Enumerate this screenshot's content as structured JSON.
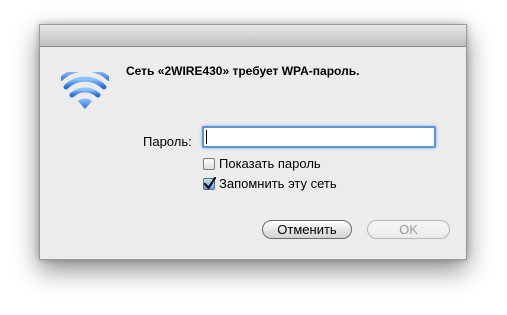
{
  "dialog": {
    "message": "Сеть «2WIRE430» требует WPA-пароль.",
    "icon": "wifi-icon"
  },
  "form": {
    "password_label": "Пароль:",
    "password_value": "",
    "show_password_label": "Показать пароль",
    "show_password_checked": false,
    "remember_network_label": "Запомнить эту сеть",
    "remember_network_checked": true
  },
  "buttons": {
    "cancel_label": "Отменить",
    "ok_label": "OK",
    "ok_enabled": false
  },
  "colors": {
    "accent": "#5f93d3",
    "wifi_icon": "#4a8fe0"
  }
}
